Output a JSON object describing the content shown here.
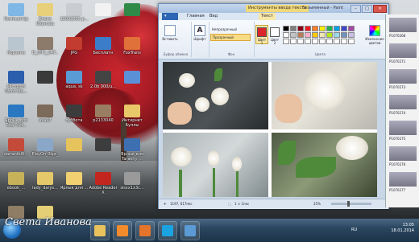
{
  "desktop": {
    "icons": [
      {
        "label": "Компьютер",
        "color": "#7fb7e6"
      },
      {
        "label": "Елена Иванова",
        "color": "#e8d07b"
      },
      {
        "label": "19092555 р...",
        "color": "#c9ccd0"
      },
      {
        "label": "",
        "color": "#f2f2f2"
      },
      {
        "label": "",
        "color": "#2f8a47"
      },
      {
        "label": "Корзина",
        "color": "#b9c6cf"
      },
      {
        "label": "D_0IT2_047..",
        "color": "#8c7b6b"
      },
      {
        "label": "JPG",
        "color": "#c23c2f"
      },
      {
        "label": "Бесплатн",
        "color": "#3c7dc9"
      },
      {
        "label": "FoxTrans",
        "color": "#e0713a"
      },
      {
        "label": "Microsoft Word Sta...",
        "color": "#2b5fad"
      },
      {
        "label": "",
        "color": "#3a3a3a"
      },
      {
        "label": "aqua, sk",
        "color": "#5a9bd5"
      },
      {
        "label": "2.0b 000/u...",
        "color": "#444"
      },
      {
        "label": "",
        "color": "#5b8fd6"
      },
      {
        "label": "Ярлык для Total Vid...",
        "color": "#2b78c2"
      },
      {
        "label": "ava27",
        "color": "#7c6a5a"
      },
      {
        "label": "суббота",
        "color": "#3c3c3c"
      },
      {
        "label": "p2133040",
        "color": "#9a7e62"
      },
      {
        "label": "Интернет Буллы",
        "color": "#e9c86a"
      },
      {
        "label": "dariantkl6...",
        "color": "#c44a3a"
      },
      {
        "label": "PlayOn_3tpr_",
        "color": "#8aa7c8"
      },
      {
        "label": "",
        "color": "#e6c35c"
      },
      {
        "label": "",
        "color": "#3d3d3d"
      },
      {
        "label": "Ярлык для Tarakhy ...",
        "color": "#3e6fb0"
      },
      {
        "label": "ebook_...",
        "color": "#c7b25a"
      },
      {
        "label": "lady_darys...",
        "color": "#e4c86a"
      },
      {
        "label": "Ярлык для ...",
        "color": "#f0d070"
      },
      {
        "label": "Adobe Reader X",
        "color": "#c2261f"
      },
      {
        "label": "sisxx1x3c...",
        "color": "#9a9a9a"
      },
      {
        "label": "anka14.ad...",
        "color": "#8f7d65"
      },
      {
        "label": "Ярлык для ...",
        "color": "#e5cf76"
      }
    ]
  },
  "paint": {
    "context_tab": "Инструменты ввода текста",
    "title": "Безымянный - Paint",
    "tabs": {
      "file": "",
      "home": "Главная",
      "view": "Вид",
      "text": "Текст"
    },
    "ribbon": {
      "paste": "Вставить",
      "font_label": "Шрифт",
      "opaque": "Непрозрачный",
      "transparent": "Прозрачный",
      "background_group": "Фон",
      "clipboard_group": "Буфер обмена",
      "color1_label": "Цвет 1",
      "color2_label": "Цвет 2",
      "colors_group": "Цвета",
      "edit_colors": "Изменение цветов",
      "palette": [
        "#000000",
        "#7f7f7f",
        "#880015",
        "#ed1c24",
        "#ff7f27",
        "#fff200",
        "#22b14c",
        "#00a2e8",
        "#3f48cc",
        "#a349a4",
        "#ffffff",
        "#c3c3c3",
        "#b97a57",
        "#ffaec9",
        "#ffc90e",
        "#efe4b0",
        "#b5e61d",
        "#99d9ea",
        "#7092be",
        "#c8bfe7",
        "#ffffff",
        "#ffffff",
        "#ffffff",
        "#ffffff",
        "#ffffff",
        "#ffffff",
        "#ffffff",
        "#ffffff",
        "#ffffff",
        "#ffffff"
      ]
    },
    "status": {
      "cursor": "1197, 617пкс",
      "selection": "1 × 1пкс",
      "zoom": "25%"
    }
  },
  "sidewin": {
    "items": [
      "P1070268",
      "P1070271",
      "P1070273",
      "P1070274",
      "P1070275",
      "P1070276",
      "P1070277"
    ],
    "size": "18.01.2014"
  },
  "watermark": "Света Иванова",
  "taskbar": {
    "icons": [
      {
        "name": "folder",
        "color": "#e9c25d"
      },
      {
        "name": "media",
        "color": "#f28b2b"
      },
      {
        "name": "firefox",
        "color": "#e5742d"
      },
      {
        "name": "skype",
        "color": "#1aa3e0"
      },
      {
        "name": "paint",
        "color": "#5b9bd5"
      }
    ],
    "lang": "RU",
    "time": "13:05",
    "date": "18.01.2014"
  }
}
